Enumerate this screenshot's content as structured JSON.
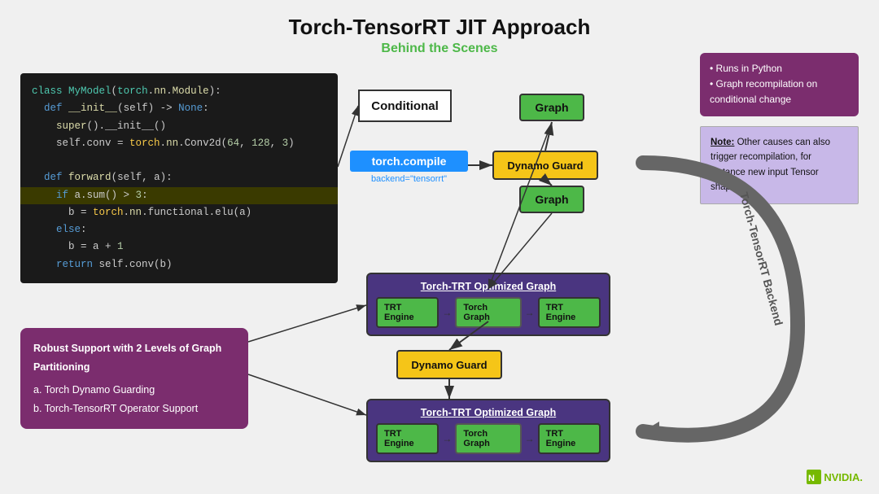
{
  "title": "Torch-TensorRT JIT Approach",
  "subtitle": "Behind the Scenes",
  "code": {
    "lines": [
      {
        "text": "class MyModel(torch.nn.Module):",
        "type": "normal"
      },
      {
        "text": "    def __init__(self) -> None:",
        "type": "normal"
      },
      {
        "text": "        super().__init__()",
        "type": "normal"
      },
      {
        "text": "        self.conv = torch.nn.Conv2d(64, 128, 3)",
        "type": "normal"
      },
      {
        "text": "",
        "type": "normal"
      },
      {
        "text": "    def forward(self, a):",
        "type": "normal"
      },
      {
        "text": "        if a.sum() > 3:",
        "type": "highlight"
      },
      {
        "text": "            b = torch.nn.functional.elu(a)",
        "type": "normal"
      },
      {
        "text": "        else:",
        "type": "normal"
      },
      {
        "text": "            b = a + 1",
        "type": "normal"
      },
      {
        "text": "        return self.conv(b)",
        "type": "normal"
      }
    ]
  },
  "conditional_label": "Conditional",
  "compile": {
    "label": "torch.compile",
    "sublabel": "backend=\"tensorrt\""
  },
  "dynamo_guard_label": "Dynamo Guard",
  "graph_label": "Graph",
  "trt_optimized": {
    "title": "Torch-TRT Optimized Graph",
    "engine1": "TRT Engine",
    "torch_graph": "Torch Graph",
    "engine2": "TRT Engine"
  },
  "notes": {
    "pink": {
      "items": [
        "Runs in Python",
        "Graph recompilation on conditional change"
      ]
    },
    "lavender": {
      "title": "Note:",
      "text": "Other causes can also trigger recompilation, for instance new input Tensor shapes."
    }
  },
  "robust": {
    "title": "Robust Support with 2 Levels of Graph Partitioning",
    "items": [
      "a.  Torch Dynamo Guarding",
      "b.  Torch-TensorRT Operator Support"
    ]
  },
  "backend_label": "Torch-TensorRT Backend",
  "nvidia_label": "NVIDIA."
}
